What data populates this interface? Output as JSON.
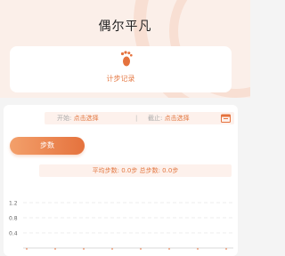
{
  "header": {
    "title": "偶尔平凡"
  },
  "card": {
    "label": "计步记录",
    "icon": "footprint-icon"
  },
  "date_filter": {
    "start_label": "开始:",
    "start_value": "点击选择",
    "separator": "|",
    "end_label": "截止:",
    "end_value": "点击选择",
    "icon": "calendar-icon"
  },
  "tab": {
    "label": "步数"
  },
  "stats": {
    "text": "平均步数: 0.0步 总步数: 0.0步"
  },
  "chart_data": {
    "type": "line",
    "y_ticks": [
      "1.2",
      "0.8",
      "0.4"
    ],
    "series": [],
    "grid": true
  },
  "colors": {
    "accent": "#e5723d",
    "accent_light": "#fdf1ec",
    "header_bg": "#fbefe9"
  }
}
